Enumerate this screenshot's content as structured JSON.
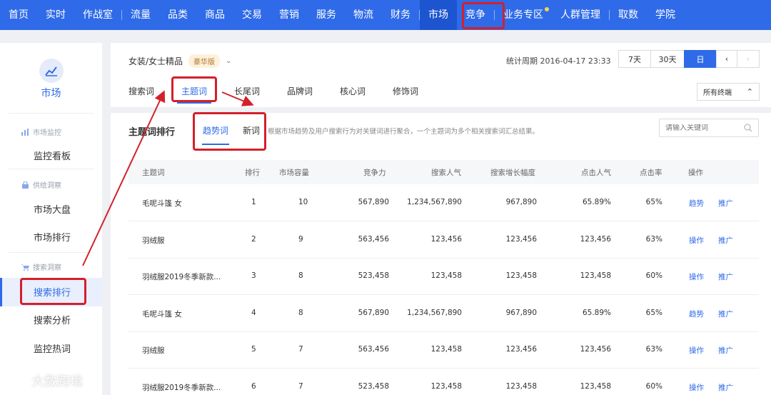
{
  "topnav": {
    "items": [
      "首页",
      "实时",
      "作战室",
      "流量",
      "品类",
      "商品",
      "交易",
      "营销",
      "服务",
      "物流",
      "财务",
      "市场",
      "竞争",
      "业务专区",
      "人群管理",
      "取数",
      "学院"
    ],
    "active": "市场"
  },
  "sidebar": {
    "title": "市场",
    "groups": [
      {
        "label": "市场监控",
        "icon": "bar-chart-icon"
      },
      {
        "label": "供给洞察",
        "icon": "lock-icon"
      },
      {
        "label": "搜索洞察",
        "icon": "cart-icon"
      }
    ],
    "items": [
      "监控看板",
      "市场大盘",
      "市场排行",
      "搜索排行",
      "搜索分析",
      "监控热词"
    ],
    "active": "搜索排行"
  },
  "filter": {
    "category": "女装/女士精品",
    "edition_badge": "豪华版",
    "period": "统计周期 2016-04-17 23:33",
    "range_buttons": [
      "7天",
      "30天",
      "日"
    ],
    "active_range": "日",
    "keyword_tabs": [
      "搜索词",
      "主题词",
      "长尾词",
      "品牌词",
      "核心词",
      "修饰词"
    ],
    "active_keyword_tab": "主题词",
    "terminal": "所有终端"
  },
  "ranking": {
    "title": "主题词排行",
    "sub_tabs": [
      "趋势词",
      "新词"
    ],
    "active_sub_tab": "趋势词",
    "description": "根据市场趋势及用户搜索行为对关键词进行聚合，一个主题词为多个相关搜索词汇总结果。",
    "search_placeholder": "请输入关键词",
    "columns": [
      "主题词",
      "排行",
      "市场容量",
      "竞争力",
      "搜索人气",
      "搜索增长幅度",
      "点击人气",
      "点击率",
      "操作"
    ],
    "rows": [
      {
        "word": "毛呢斗篷 女",
        "rank": "1",
        "capacity": "10",
        "competition": "567,890",
        "search_pop": "1,234,567,890",
        "growth": "967,890",
        "click_pop": "65.89%",
        "ctr": "65%",
        "op1": "趋势",
        "op2": "推广"
      },
      {
        "word": "羽绒服",
        "rank": "2",
        "capacity": "9",
        "competition": "563,456",
        "search_pop": "123,456",
        "growth": "123,456",
        "click_pop": "123,456",
        "ctr": "63%",
        "op1": "操作",
        "op2": "推广"
      },
      {
        "word": "羽绒服2019冬季新款...",
        "rank": "3",
        "capacity": "8",
        "competition": "523,458",
        "search_pop": "123,458",
        "growth": "123,458",
        "click_pop": "123,458",
        "ctr": "60%",
        "op1": "操作",
        "op2": "推广"
      },
      {
        "word": "毛呢斗篷 女",
        "rank": "4",
        "capacity": "8",
        "competition": "567,890",
        "search_pop": "1,234,567,890",
        "growth": "967,890",
        "click_pop": "65.89%",
        "ctr": "65%",
        "op1": "趋势",
        "op2": "推广"
      },
      {
        "word": "羽绒服",
        "rank": "5",
        "capacity": "7",
        "competition": "563,456",
        "search_pop": "123,458",
        "growth": "123,456",
        "click_pop": "123,456",
        "ctr": "63%",
        "op1": "操作",
        "op2": "推广"
      },
      {
        "word": "羽绒服2019冬季新款...",
        "rank": "6",
        "capacity": "7",
        "competition": "523,458",
        "search_pop": "123,458",
        "growth": "123,458",
        "click_pop": "123,458",
        "ctr": "60%",
        "op1": "操作",
        "op2": "推广"
      }
    ]
  },
  "watermark": "大数跨境",
  "colors": {
    "brand": "#2f6be8",
    "highlight": "#d4202a",
    "badge_bg": "#fdf1dc"
  }
}
